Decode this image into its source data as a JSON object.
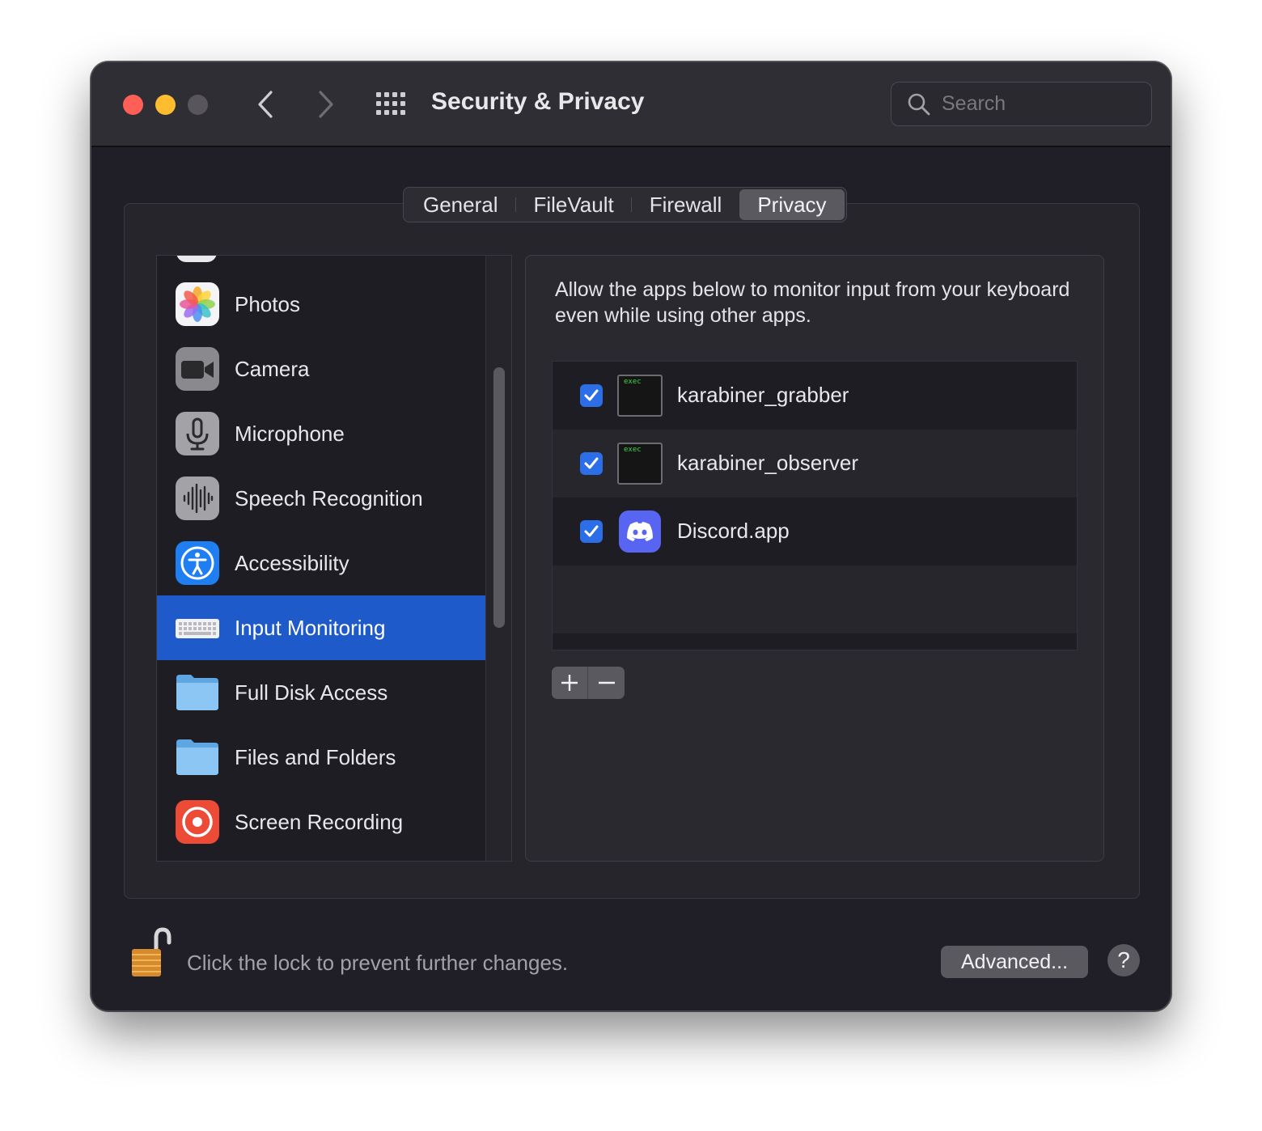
{
  "window": {
    "title": "Security & Privacy"
  },
  "search": {
    "placeholder": "Search"
  },
  "tabs": [
    {
      "label": "General"
    },
    {
      "label": "FileVault"
    },
    {
      "label": "Firewall"
    },
    {
      "label": "Privacy"
    }
  ],
  "active_tab": "Privacy",
  "sidebar": {
    "items": [
      {
        "label": "Photos",
        "icon": "photos-icon"
      },
      {
        "label": "Camera",
        "icon": "camera-icon"
      },
      {
        "label": "Microphone",
        "icon": "microphone-icon"
      },
      {
        "label": "Speech Recognition",
        "icon": "waveform-icon"
      },
      {
        "label": "Accessibility",
        "icon": "accessibility-icon"
      },
      {
        "label": "Input Monitoring",
        "icon": "keyboard-icon"
      },
      {
        "label": "Full Disk Access",
        "icon": "folder-icon"
      },
      {
        "label": "Files and Folders",
        "icon": "folder-icon"
      },
      {
        "label": "Screen Recording",
        "icon": "screen-recording-icon"
      }
    ],
    "selected": "Input Monitoring"
  },
  "panel": {
    "description": "Allow the apps below to monitor input from your keyboard even while using other apps.",
    "apps": [
      {
        "name": "karabiner_grabber",
        "checked": true,
        "icon": "exec-icon",
        "icon_text": "exec"
      },
      {
        "name": "karabiner_observer",
        "checked": true,
        "icon": "exec-icon",
        "icon_text": "exec"
      },
      {
        "name": "Discord.app",
        "checked": true,
        "icon": "discord-icon"
      }
    ]
  },
  "footer": {
    "lock_message": "Click the lock to prevent further changes.",
    "advanced_label": "Advanced...",
    "help_label": "?"
  },
  "colors": {
    "accent": "#1e5ac9",
    "checkbox": "#2b6ee8",
    "close": "#fe5f57",
    "minimize": "#febc2e"
  }
}
